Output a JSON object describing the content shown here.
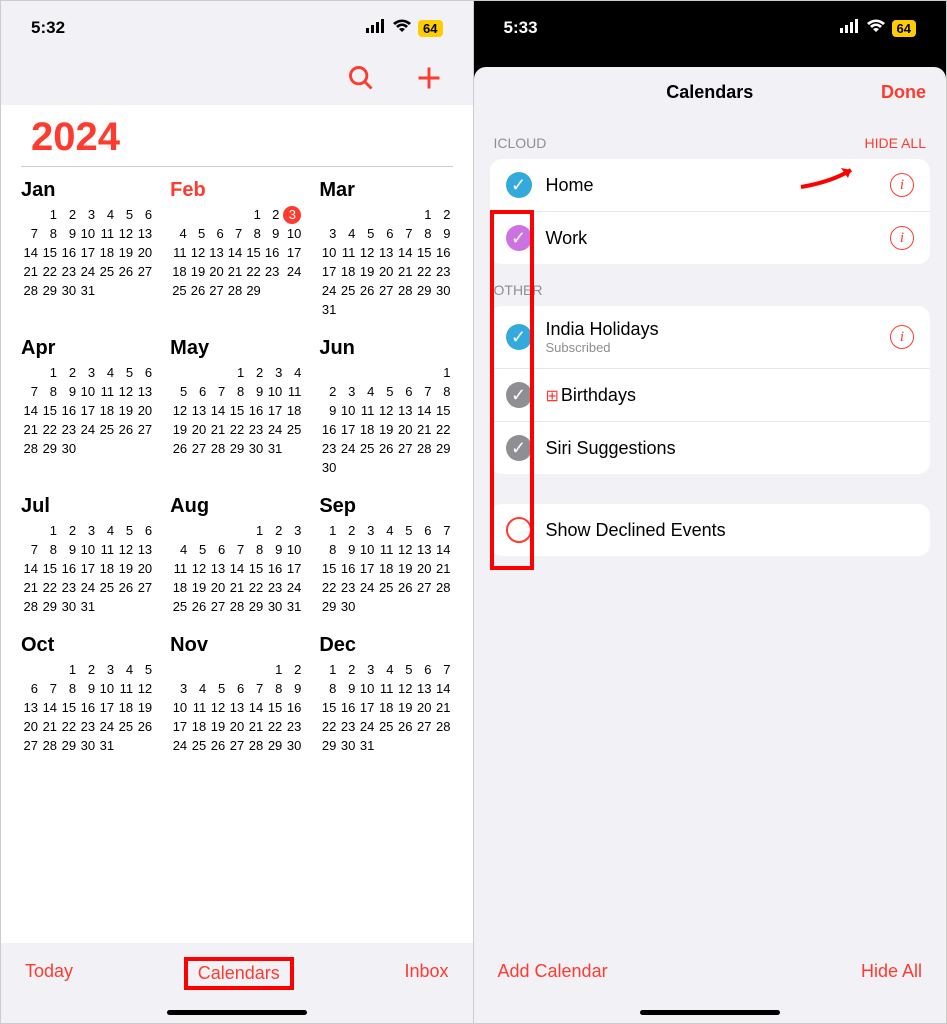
{
  "left": {
    "status_time": "5:32",
    "battery": "64",
    "year": "2024",
    "today_btn": "Today",
    "calendars_btn": "Calendars",
    "inbox_btn": "Inbox",
    "months": [
      {
        "name": "Jan",
        "red": false,
        "offset": 1,
        "days": 31
      },
      {
        "name": "Feb",
        "red": true,
        "offset": 4,
        "days": 29,
        "today": 3
      },
      {
        "name": "Mar",
        "red": false,
        "offset": 5,
        "days": 31
      },
      {
        "name": "Apr",
        "red": false,
        "offset": 1,
        "days": 30
      },
      {
        "name": "May",
        "red": false,
        "offset": 3,
        "days": 31
      },
      {
        "name": "Jun",
        "red": false,
        "offset": 6,
        "days": 30
      },
      {
        "name": "Jul",
        "red": false,
        "offset": 1,
        "days": 31
      },
      {
        "name": "Aug",
        "red": false,
        "offset": 4,
        "days": 31
      },
      {
        "name": "Sep",
        "red": false,
        "offset": 0,
        "days": 30
      },
      {
        "name": "Oct",
        "red": false,
        "offset": 2,
        "days": 31
      },
      {
        "name": "Nov",
        "red": false,
        "offset": 5,
        "days": 30
      },
      {
        "name": "Dec",
        "red": false,
        "offset": 0,
        "days": 31
      }
    ]
  },
  "right": {
    "status_time": "5:33",
    "battery": "64",
    "title": "Calendars",
    "done": "Done",
    "icloud_header": "ICLOUD",
    "hide_all_header": "HIDE ALL",
    "other_header": "OTHER",
    "home": "Home",
    "work": "Work",
    "india": "India Holidays",
    "subscribed": "Subscribed",
    "birthdays": "Birthdays",
    "siri": "Siri Suggestions",
    "declined": "Show Declined Events",
    "add_calendar": "Add Calendar",
    "hide_all_btn": "Hide All"
  }
}
